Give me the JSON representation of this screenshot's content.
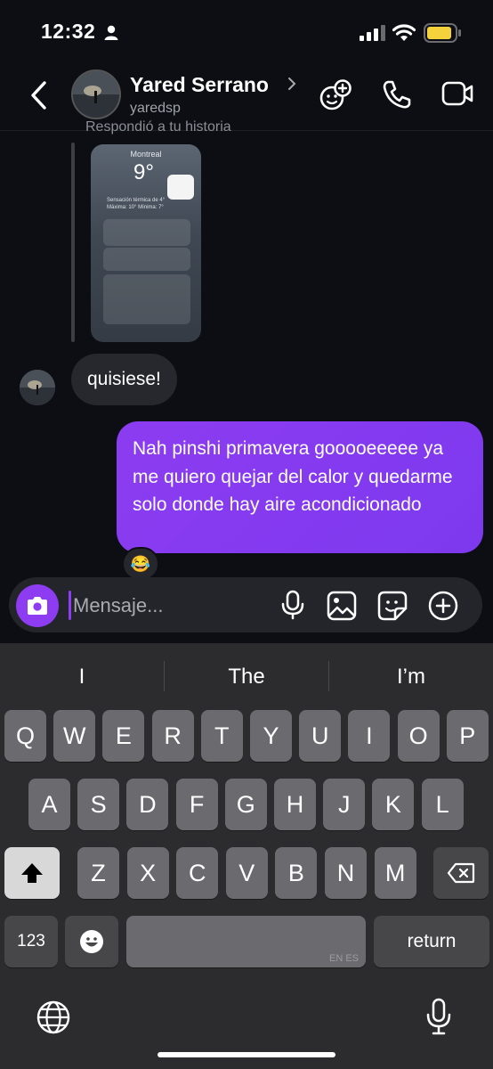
{
  "status_bar": {
    "time": "12:32",
    "battery_color": "#f4d23b"
  },
  "header": {
    "name": "Yared Serrano",
    "username": "yaredsp",
    "icons": [
      "back-arrow-icon",
      "effects-icon",
      "phone-icon",
      "video-icon"
    ]
  },
  "chat": {
    "story_caption": "Respondió a tu historia",
    "story_preview": {
      "city": "Montreal",
      "temp": "9°",
      "feels": "Sensación térmica de 4°",
      "range": "Máxima: 10°  Mínima: 7°"
    },
    "incoming_message": "quisiese!",
    "outgoing_message": "Nah pinshi primavera gooooeeeee ya me quiero quejar del calor y quedarme solo donde hay aire acondicionado",
    "reaction": "😂"
  },
  "composer": {
    "placeholder": "Mensaje..."
  },
  "keyboard": {
    "suggestions": [
      "I",
      "The",
      "I’m"
    ],
    "row1": [
      "Q",
      "W",
      "E",
      "R",
      "T",
      "Y",
      "U",
      "I",
      "O",
      "P"
    ],
    "row2": [
      "A",
      "S",
      "D",
      "F",
      "G",
      "H",
      "J",
      "K",
      "L"
    ],
    "row3": [
      "Z",
      "X",
      "C",
      "V",
      "B",
      "N",
      "M"
    ],
    "numbers_key": "123",
    "space_lang": "EN ES",
    "return_key": "return"
  }
}
